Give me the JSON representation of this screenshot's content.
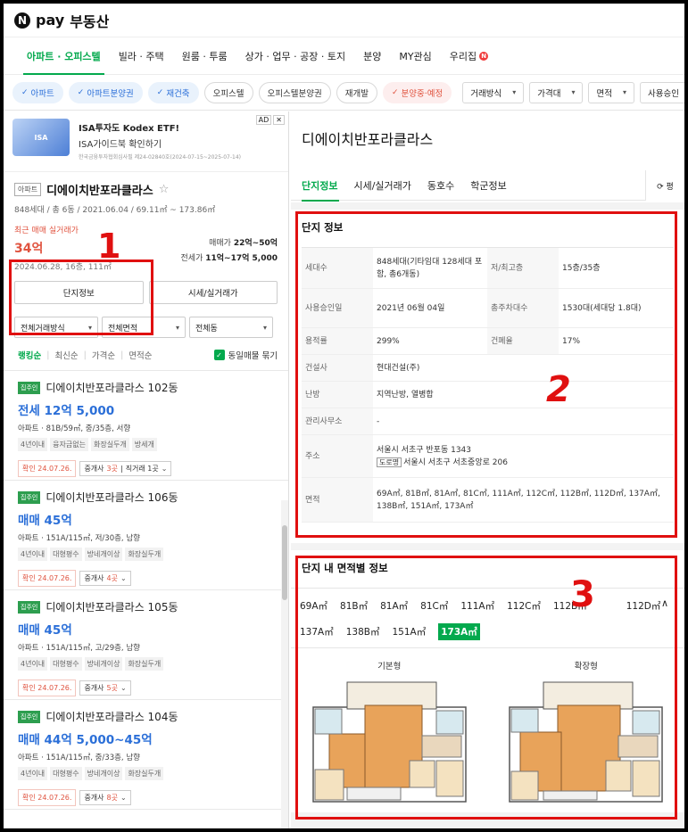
{
  "brand": {
    "logo": "N",
    "pay": "pay",
    "name": "부동산"
  },
  "gnb": [
    {
      "label": "아파트 · 오피스텔",
      "active": true
    },
    {
      "label": "빌라 · 주택"
    },
    {
      "label": "원룸 · 투룸"
    },
    {
      "label": "상가 · 업무 · 공장 · 토지"
    },
    {
      "label": "분양"
    },
    {
      "label": "MY관심"
    },
    {
      "label": "우리집",
      "badge": "N"
    }
  ],
  "filters": {
    "chips": [
      {
        "label": "아파트",
        "style": "blue",
        "check": "✓"
      },
      {
        "label": "아파트분양권",
        "style": "blue",
        "check": "✓"
      },
      {
        "label": "재건축",
        "style": "blue",
        "check": "✓"
      },
      {
        "label": "오피스텔",
        "style": ""
      },
      {
        "label": "오피스텔분양권",
        "style": ""
      },
      {
        "label": "재개발",
        "style": ""
      },
      {
        "label": "분양중·예정",
        "style": "pink",
        "check": "✓"
      }
    ],
    "selects": [
      "거래방식",
      "가격대",
      "면적",
      "사용승인"
    ]
  },
  "ad": {
    "thumb": "ISA",
    "title": "ISA투자도 Kodex ETF!",
    "subtitle": "ISA가이드북 확인하기",
    "fine": "한국금융투자협회심사필 제24-02840호(2024-07-15~2025-07-14)",
    "tag": "AD",
    "close": "✕"
  },
  "complex": {
    "type_tag": "아파트",
    "name": "디에이치반포라클라스",
    "star": "☆",
    "meta": "848세대 / 총 6동 / 2021.06.04 / 69.11㎡ ~ 173.86㎡",
    "recent_label": "최근 매매 실거래가",
    "recent_price": "34억",
    "recent_date": "2024.06.28, 16층, 111㎡",
    "sale_label": "매매가",
    "sale_range": "22억~50억",
    "jeonse_label": "전세가",
    "jeonse_range": "11억~17억 5,000",
    "btn_info": "단지정보",
    "btn_price": "시세/실거래가"
  },
  "dropdowns": [
    "전체거래방식",
    "전체면적",
    "전체동"
  ],
  "sort": {
    "options": [
      "랭킹순",
      "최신순",
      "가격순",
      "면적순"
    ],
    "same_listing": "동일매물 묶기",
    "check": "✓"
  },
  "listings": [
    {
      "badge": "집주인",
      "name": "디에이치반포라클라스 102동",
      "price": "전세 12억 5,000",
      "spec": "아파트 · 81B/59㎡, 중/35층, 서향",
      "tags": [
        "4년이내",
        "융자금없는",
        "화장실두개",
        "방세개"
      ],
      "confirm": "확인 24.07.26.",
      "agent": "중개사 ",
      "agent_n": "3곳",
      "extra": "직거래 1곳"
    },
    {
      "badge": "집주인",
      "name": "디에이치반포라클라스 106동",
      "price": "매매 45억",
      "spec": "아파트 · 151A/115㎡, 저/30층, 남향",
      "tags": [
        "4년이내",
        "대형평수",
        "방네개이상",
        "화장실두개"
      ],
      "confirm": "확인 24.07.26.",
      "agent": "중개사 ",
      "agent_n": "4곳",
      "extra": ""
    },
    {
      "badge": "집주인",
      "name": "디에이치반포라클라스 105동",
      "price": "매매 45억",
      "spec": "아파트 · 151A/115㎡, 고/29층, 남향",
      "tags": [
        "4년이내",
        "대형평수",
        "방네개이상",
        "화장실두개"
      ],
      "confirm": "확인 24.07.26.",
      "agent": "중개사 ",
      "agent_n": "5곳",
      "extra": ""
    },
    {
      "badge": "집주인",
      "name": "디에이치반포라클라스 104동",
      "price": "매매 44억 5,000~45억",
      "spec": "아파트 · 151A/115㎡, 중/33층, 남향",
      "tags": [
        "4년이내",
        "대형평수",
        "방네개이상",
        "화장실두개"
      ],
      "confirm": "확인 24.07.26.",
      "agent": "중개사 ",
      "agent_n": "8곳",
      "extra": ""
    }
  ],
  "detail": {
    "title": "디에이치반포라클라스",
    "tabs": [
      "단지정보",
      "시세/실거래가",
      "동호수",
      "학군정보"
    ],
    "refresh": "⟳ 평",
    "info_title": "단지 정보",
    "info_rows": {
      "r1": {
        "k1": "세대수",
        "v1": "848세대(기타임대 128세대 포함, 총6개동)",
        "k2": "저/최고층",
        "v2": "15층/35층"
      },
      "r2": {
        "k1": "사용승인일",
        "v1": "2021년 06월 04일",
        "k2": "총주차대수",
        "v2": "1530대(세대당 1.8대)"
      },
      "r3": {
        "k1": "용적률",
        "v1": "299%",
        "k2": "건폐율",
        "v2": "17%"
      },
      "r4": {
        "k1": "건설사",
        "v1": "현대건설(주)"
      },
      "r5": {
        "k1": "난방",
        "v1": "지역난방, 열병합"
      },
      "r6": {
        "k1": "관리사무소",
        "v1": "-"
      },
      "r7": {
        "k1": "주소",
        "v1": "서울시 서초구 반포동 1343",
        "road_badge": "도로명",
        "v1b": "서울시 서초구 서초중앙로 206"
      },
      "r8": {
        "k1": "면적",
        "v1": "69A㎡, 81B㎡, 81A㎡, 81C㎡, 111A㎡, 112C㎡, 112B㎡, 112D㎡, 137A㎡, 138B㎡, 151A㎡, 173A㎡"
      }
    },
    "area_title": "단지 내 면적별 정보",
    "areas": [
      "69A㎡",
      "81B㎡",
      "81A㎡",
      "81C㎡",
      "111A㎡",
      "112C㎡",
      "112B㎡",
      "112D㎡",
      "137A㎡",
      "138B㎡",
      "151A㎡",
      "173A㎡"
    ],
    "selected_area": "173A㎡",
    "collapse": "∧",
    "plan_labels": [
      "기본형",
      "확장형"
    ]
  },
  "annotations": [
    "1",
    "2",
    "3"
  ],
  "colors": {
    "accent_green": "#03a94d",
    "price_blue": "#2b6fd8",
    "annotation_red": "#e01010",
    "recent_red": "#e0533f"
  }
}
